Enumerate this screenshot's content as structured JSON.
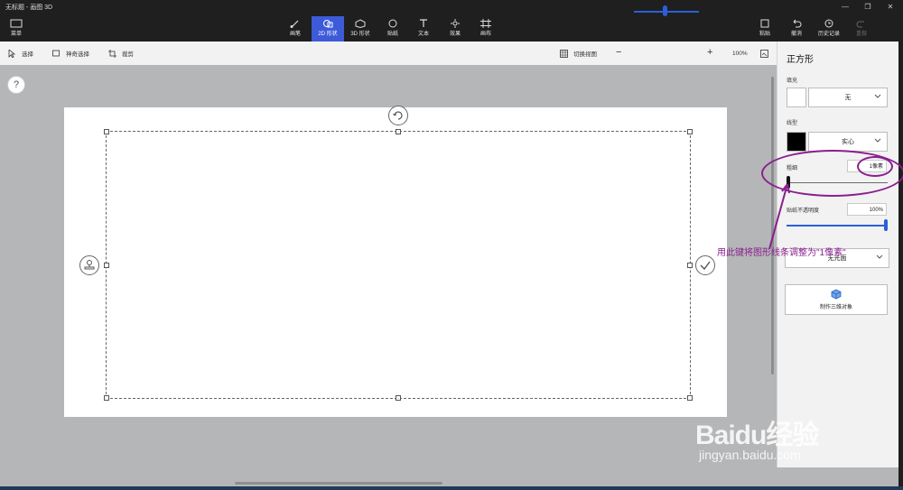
{
  "window": {
    "title": "无标题 - 画图 3D"
  },
  "ribbon": {
    "menu_label": "菜单",
    "tools": [
      {
        "label": "画笔",
        "icon": "brush-icon"
      },
      {
        "label": "2D 形状",
        "icon": "2d-shapes-icon",
        "active": true
      },
      {
        "label": "3D 形状",
        "icon": "3d-shapes-icon"
      },
      {
        "label": "贴纸",
        "icon": "sticker-icon"
      },
      {
        "label": "文本",
        "icon": "text-icon"
      },
      {
        "label": "效果",
        "icon": "effects-icon"
      },
      {
        "label": "画布",
        "icon": "canvas-icon"
      }
    ],
    "right": [
      {
        "label": "粘贴",
        "icon": "paste-icon"
      },
      {
        "label": "撤消",
        "icon": "undo-icon"
      },
      {
        "label": "历史记录",
        "icon": "history-icon"
      },
      {
        "label": "重做",
        "icon": "redo-icon",
        "disabled": true
      }
    ]
  },
  "toolbar": {
    "select_label": "选择",
    "magic_select_label": "神奇选择",
    "crop_label": "裁剪",
    "toggle_view_label": "切换视图",
    "zoom_minus": "−",
    "zoom_plus": "+",
    "zoom_level": "100%",
    "zoom_fraction": 0.5
  },
  "canvas": {
    "help_label": "?"
  },
  "panel": {
    "title": "正方形",
    "fill_label": "填充",
    "fill_value": "无",
    "line_type_label": "线型",
    "line_type_value": "实心",
    "thickness_label": "粗细",
    "thickness_value": "1像素",
    "opacity_label": "贴纸不透明度",
    "opacity_value": "100%",
    "finish_value": "无光面",
    "make3d_label": "制作三维对象",
    "colors": {
      "fill": "#ffffff",
      "line": "#000000"
    }
  },
  "annotation": {
    "text": "用此键将图形线条调整为\"1像素\"",
    "color": "#8a1f8e"
  },
  "watermark": {
    "logo": "Baidu经验",
    "url": "jingyan.baidu.com"
  }
}
